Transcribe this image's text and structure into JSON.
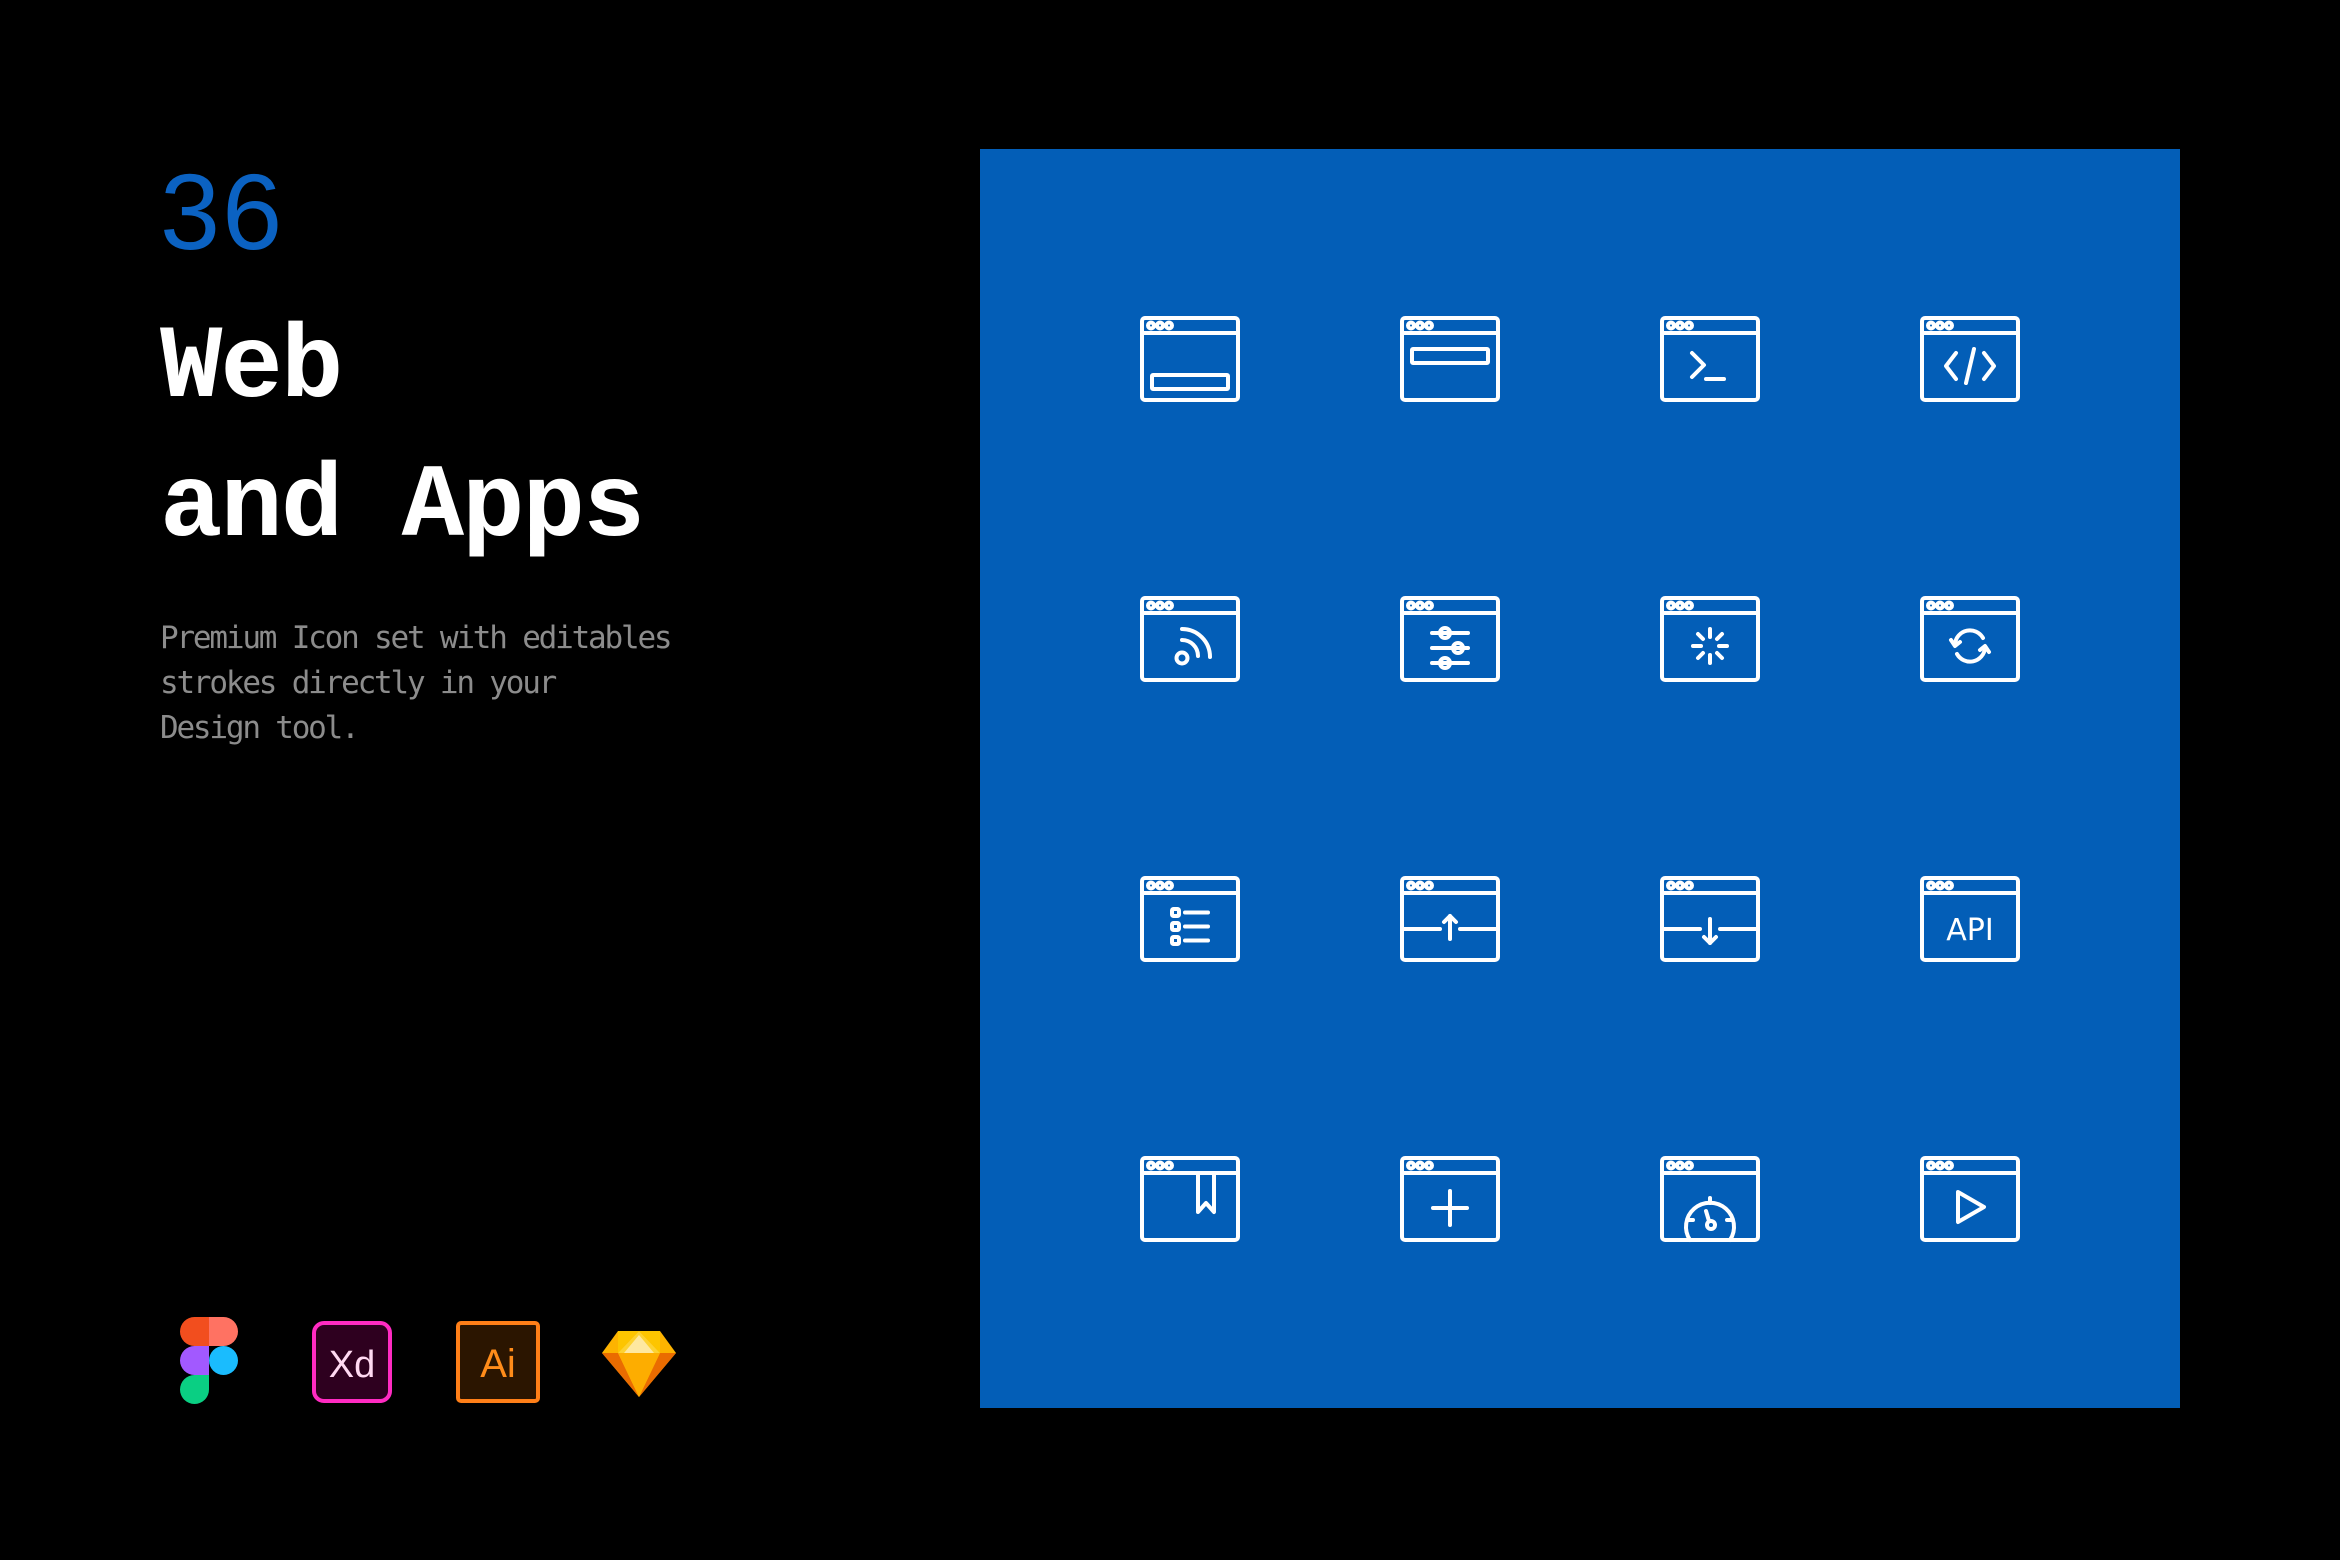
{
  "hero": {
    "count": "36",
    "title_lines": [
      "Web",
      "and Apps"
    ],
    "description_lines": [
      "Premium Icon set with editables",
      "strokes directly in your",
      "Design tool."
    ]
  },
  "colors": {
    "background": "#000000",
    "accent_blue": "#0b62c2",
    "panel_blue": "#035eb7",
    "icon_stroke": "#ffffff",
    "description_gray": "#8c8c8c"
  },
  "tools": [
    {
      "name": "Figma",
      "icon": "figma-logo-icon"
    },
    {
      "name": "Adobe XD",
      "icon": "adobe-xd-logo-icon",
      "label": "Xd"
    },
    {
      "name": "Adobe Illustrator",
      "icon": "adobe-illustrator-logo-icon",
      "label": "Ai"
    },
    {
      "name": "Sketch",
      "icon": "sketch-logo-icon"
    }
  ],
  "icon_grid": {
    "rows": [
      [
        "browser-bottom-bar",
        "browser-top-bar",
        "browser-terminal",
        "browser-code"
      ],
      [
        "browser-rss",
        "browser-settings-sliders",
        "browser-loading",
        "browser-sync"
      ],
      [
        "browser-list",
        "browser-upload",
        "browser-download",
        "browser-api"
      ],
      [
        "browser-bookmark",
        "browser-add",
        "browser-speed",
        "browser-play"
      ]
    ],
    "api_label": "API"
  }
}
